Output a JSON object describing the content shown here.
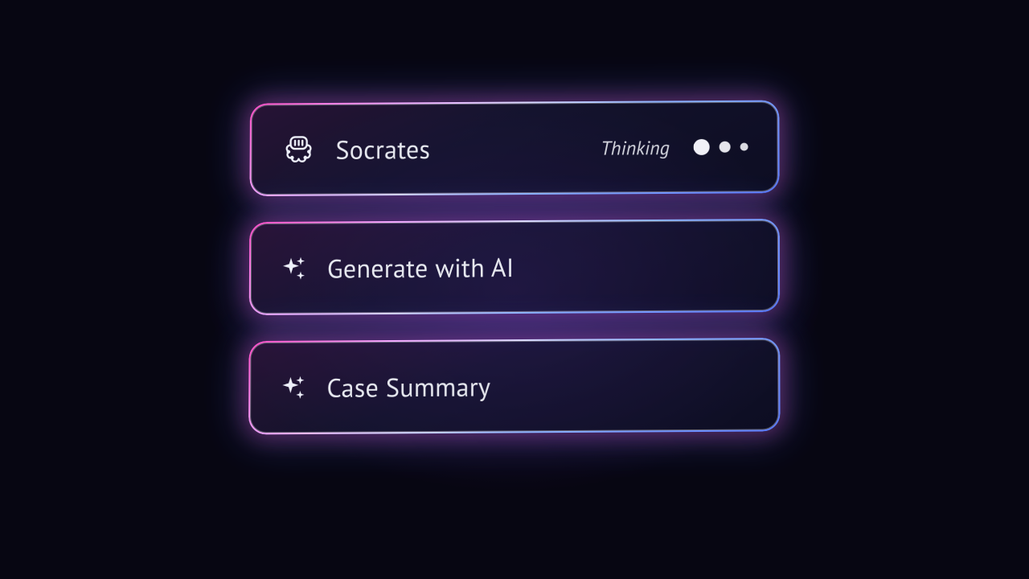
{
  "cards": [
    {
      "title": "Socrates",
      "icon_name": "brain-chip-icon",
      "status_label": "Thinking",
      "show_dots": true
    },
    {
      "title": "Generate with AI",
      "icon_name": "sparkles-icon",
      "status_label": null,
      "show_dots": false
    },
    {
      "title": "Case Summary",
      "icon_name": "sparkles-icon",
      "status_label": null,
      "show_dots": false
    }
  ],
  "colors": {
    "magenta": "#ff4ec8",
    "blue": "#5a7bff",
    "violet": "#b98bff",
    "background": "#070612"
  }
}
